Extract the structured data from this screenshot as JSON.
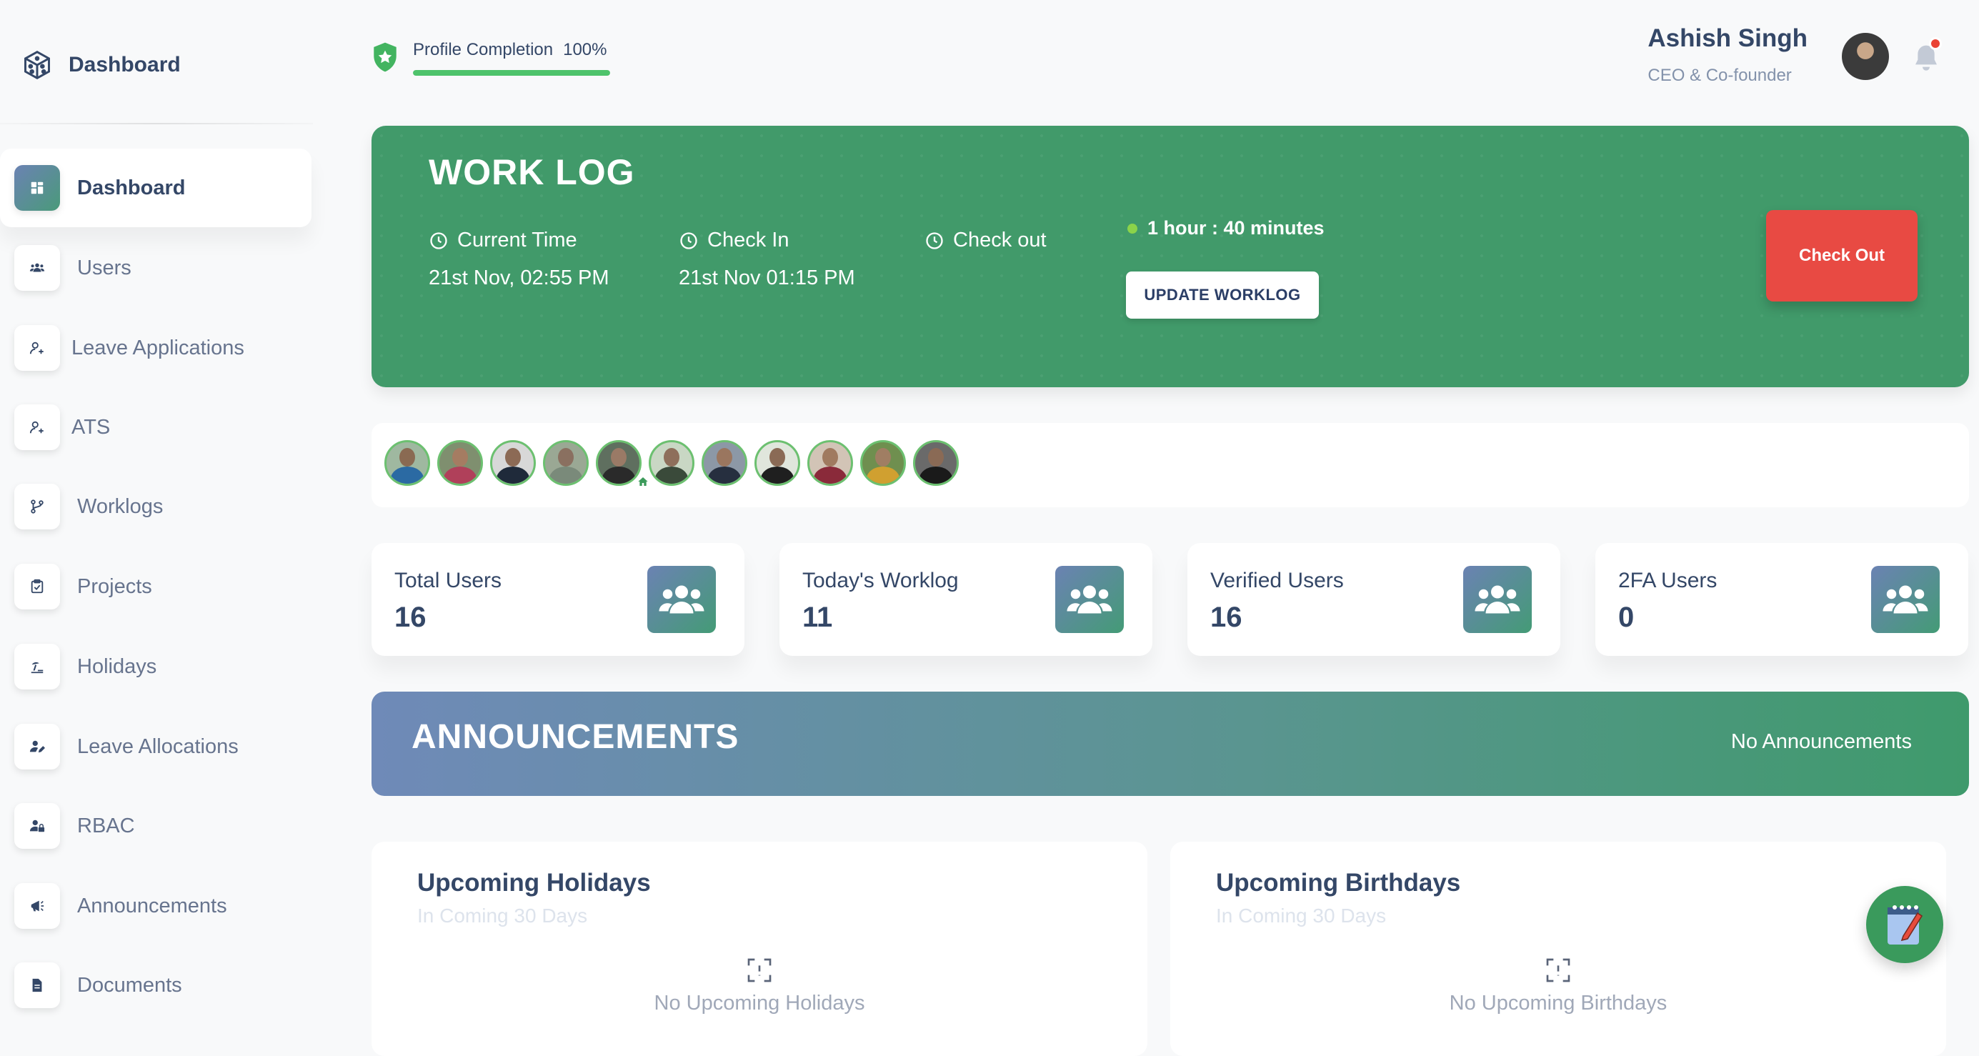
{
  "sidebar": {
    "brand": "Dashboard",
    "items": [
      {
        "label": "Dashboard",
        "icon": "dashboard-icon",
        "active": true
      },
      {
        "label": "Users",
        "icon": "users-icon"
      },
      {
        "label": "Leave Applications",
        "icon": "user-plus-icon"
      },
      {
        "label": "ATS",
        "icon": "user-plus-icon"
      },
      {
        "label": "Worklogs",
        "icon": "branch-icon"
      },
      {
        "label": "Projects",
        "icon": "clipboard-icon"
      },
      {
        "label": "Holidays",
        "icon": "beach-icon"
      },
      {
        "label": "Leave Allocations",
        "icon": "user-edit-icon"
      },
      {
        "label": "RBAC",
        "icon": "user-lock-icon"
      },
      {
        "label": "Announcements",
        "icon": "megaphone-icon"
      },
      {
        "label": "Documents",
        "icon": "document-icon"
      }
    ]
  },
  "header": {
    "profile_completion_label": "Profile Completion",
    "profile_completion_value": "100%",
    "profile_completion_fraction": 1.0,
    "user_name": "Ashish Singh",
    "user_role": "CEO & Co-founder"
  },
  "worklog": {
    "title": "WORK LOG",
    "current_time_label": "Current Time",
    "current_time_value": "21st Nov, 02:55 PM",
    "check_in_label": "Check In",
    "check_in_value": "21st Nov 01:15 PM",
    "check_out_label": "Check out",
    "duration": "1 hour : 40 minutes",
    "update_button": "UPDATE WORKLOG",
    "checkout_button": "Check Out"
  },
  "stats": [
    {
      "label": "Total Users",
      "value": "16"
    },
    {
      "label": "Today's Worklog",
      "value": "11"
    },
    {
      "label": "Verified Users",
      "value": "16"
    },
    {
      "label": "2FA Users",
      "value": "0"
    }
  ],
  "announcements": {
    "title": "ANNOUNCEMENTS",
    "empty": "No Announcements"
  },
  "holidays": {
    "title": "Upcoming Holidays",
    "subtitle": "In Coming 30 Days",
    "empty": "No Upcoming Holidays"
  },
  "birthdays": {
    "title": "Upcoming Birthdays",
    "subtitle": "In Coming 30 Days",
    "empty": "No Upcoming Birthdays"
  },
  "colors": {
    "worklog_bg": "#419a6a",
    "checkout_red": "#e84a43",
    "accent_gradient_start": "#6b82b3",
    "accent_gradient_end": "#449b76",
    "progress_green": "#4ec36b"
  }
}
